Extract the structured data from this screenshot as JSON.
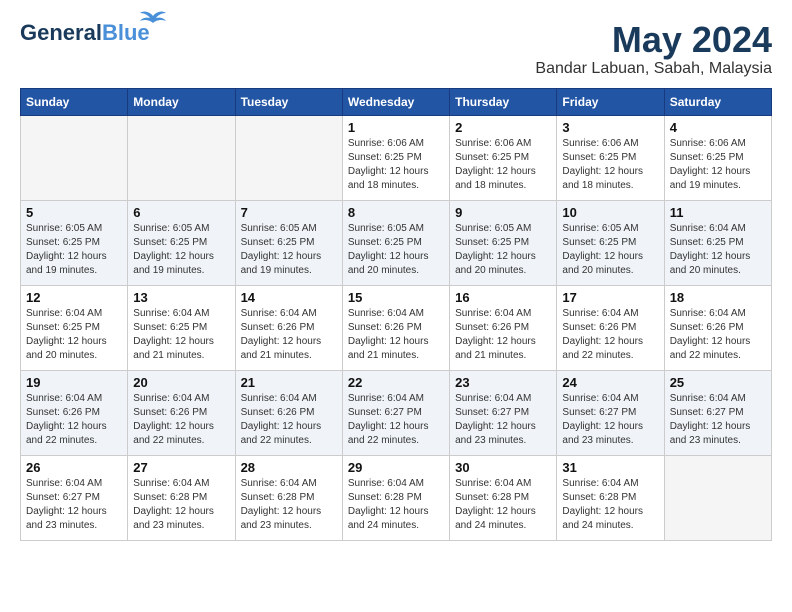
{
  "logo": {
    "general": "General",
    "blue": "Blue"
  },
  "header": {
    "month": "May 2024",
    "location": "Bandar Labuan, Sabah, Malaysia"
  },
  "weekdays": [
    "Sunday",
    "Monday",
    "Tuesday",
    "Wednesday",
    "Thursday",
    "Friday",
    "Saturday"
  ],
  "weeks": [
    [
      {
        "day": "",
        "info": ""
      },
      {
        "day": "",
        "info": ""
      },
      {
        "day": "",
        "info": ""
      },
      {
        "day": "1",
        "info": "Sunrise: 6:06 AM\nSunset: 6:25 PM\nDaylight: 12 hours\nand 18 minutes."
      },
      {
        "day": "2",
        "info": "Sunrise: 6:06 AM\nSunset: 6:25 PM\nDaylight: 12 hours\nand 18 minutes."
      },
      {
        "day": "3",
        "info": "Sunrise: 6:06 AM\nSunset: 6:25 PM\nDaylight: 12 hours\nand 18 minutes."
      },
      {
        "day": "4",
        "info": "Sunrise: 6:06 AM\nSunset: 6:25 PM\nDaylight: 12 hours\nand 19 minutes."
      }
    ],
    [
      {
        "day": "5",
        "info": "Sunrise: 6:05 AM\nSunset: 6:25 PM\nDaylight: 12 hours\nand 19 minutes."
      },
      {
        "day": "6",
        "info": "Sunrise: 6:05 AM\nSunset: 6:25 PM\nDaylight: 12 hours\nand 19 minutes."
      },
      {
        "day": "7",
        "info": "Sunrise: 6:05 AM\nSunset: 6:25 PM\nDaylight: 12 hours\nand 19 minutes."
      },
      {
        "day": "8",
        "info": "Sunrise: 6:05 AM\nSunset: 6:25 PM\nDaylight: 12 hours\nand 20 minutes."
      },
      {
        "day": "9",
        "info": "Sunrise: 6:05 AM\nSunset: 6:25 PM\nDaylight: 12 hours\nand 20 minutes."
      },
      {
        "day": "10",
        "info": "Sunrise: 6:05 AM\nSunset: 6:25 PM\nDaylight: 12 hours\nand 20 minutes."
      },
      {
        "day": "11",
        "info": "Sunrise: 6:04 AM\nSunset: 6:25 PM\nDaylight: 12 hours\nand 20 minutes."
      }
    ],
    [
      {
        "day": "12",
        "info": "Sunrise: 6:04 AM\nSunset: 6:25 PM\nDaylight: 12 hours\nand 20 minutes."
      },
      {
        "day": "13",
        "info": "Sunrise: 6:04 AM\nSunset: 6:25 PM\nDaylight: 12 hours\nand 21 minutes."
      },
      {
        "day": "14",
        "info": "Sunrise: 6:04 AM\nSunset: 6:26 PM\nDaylight: 12 hours\nand 21 minutes."
      },
      {
        "day": "15",
        "info": "Sunrise: 6:04 AM\nSunset: 6:26 PM\nDaylight: 12 hours\nand 21 minutes."
      },
      {
        "day": "16",
        "info": "Sunrise: 6:04 AM\nSunset: 6:26 PM\nDaylight: 12 hours\nand 21 minutes."
      },
      {
        "day": "17",
        "info": "Sunrise: 6:04 AM\nSunset: 6:26 PM\nDaylight: 12 hours\nand 22 minutes."
      },
      {
        "day": "18",
        "info": "Sunrise: 6:04 AM\nSunset: 6:26 PM\nDaylight: 12 hours\nand 22 minutes."
      }
    ],
    [
      {
        "day": "19",
        "info": "Sunrise: 6:04 AM\nSunset: 6:26 PM\nDaylight: 12 hours\nand 22 minutes."
      },
      {
        "day": "20",
        "info": "Sunrise: 6:04 AM\nSunset: 6:26 PM\nDaylight: 12 hours\nand 22 minutes."
      },
      {
        "day": "21",
        "info": "Sunrise: 6:04 AM\nSunset: 6:26 PM\nDaylight: 12 hours\nand 22 minutes."
      },
      {
        "day": "22",
        "info": "Sunrise: 6:04 AM\nSunset: 6:27 PM\nDaylight: 12 hours\nand 22 minutes."
      },
      {
        "day": "23",
        "info": "Sunrise: 6:04 AM\nSunset: 6:27 PM\nDaylight: 12 hours\nand 23 minutes."
      },
      {
        "day": "24",
        "info": "Sunrise: 6:04 AM\nSunset: 6:27 PM\nDaylight: 12 hours\nand 23 minutes."
      },
      {
        "day": "25",
        "info": "Sunrise: 6:04 AM\nSunset: 6:27 PM\nDaylight: 12 hours\nand 23 minutes."
      }
    ],
    [
      {
        "day": "26",
        "info": "Sunrise: 6:04 AM\nSunset: 6:27 PM\nDaylight: 12 hours\nand 23 minutes."
      },
      {
        "day": "27",
        "info": "Sunrise: 6:04 AM\nSunset: 6:28 PM\nDaylight: 12 hours\nand 23 minutes."
      },
      {
        "day": "28",
        "info": "Sunrise: 6:04 AM\nSunset: 6:28 PM\nDaylight: 12 hours\nand 23 minutes."
      },
      {
        "day": "29",
        "info": "Sunrise: 6:04 AM\nSunset: 6:28 PM\nDaylight: 12 hours\nand 24 minutes."
      },
      {
        "day": "30",
        "info": "Sunrise: 6:04 AM\nSunset: 6:28 PM\nDaylight: 12 hours\nand 24 minutes."
      },
      {
        "day": "31",
        "info": "Sunrise: 6:04 AM\nSunset: 6:28 PM\nDaylight: 12 hours\nand 24 minutes."
      },
      {
        "day": "",
        "info": ""
      }
    ]
  ]
}
